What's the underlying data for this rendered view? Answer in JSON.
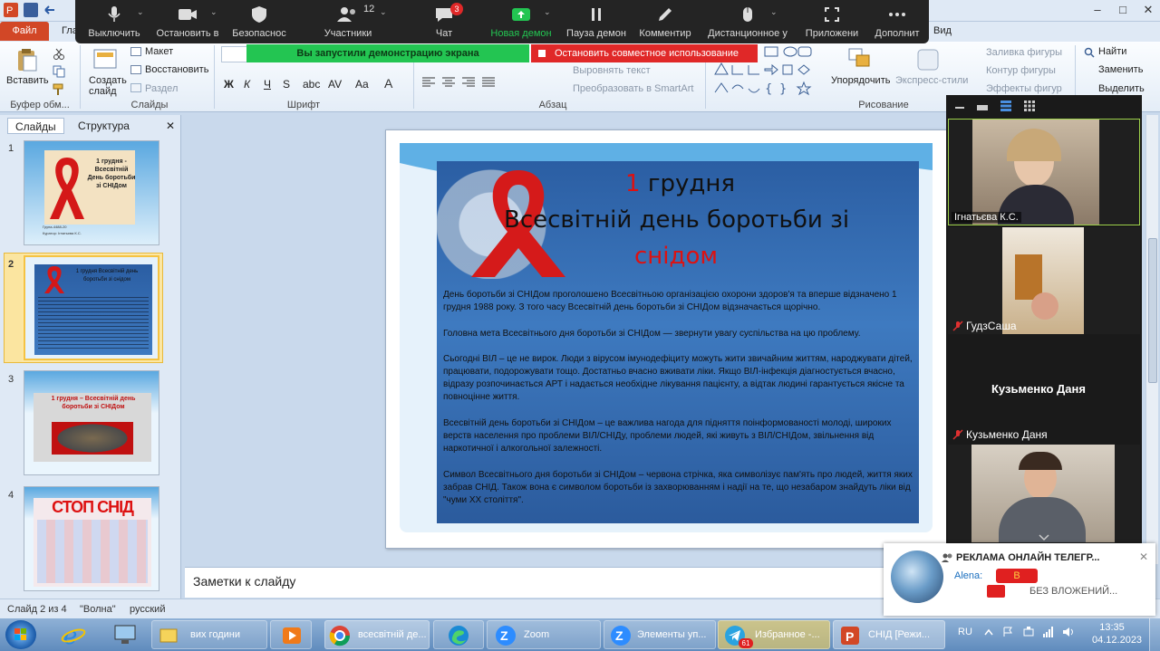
{
  "window": {
    "title": "",
    "title_right": "",
    "minimize": "–",
    "maximize": "□",
    "close": "✕"
  },
  "ribbon": {
    "file_tab": "Файл",
    "tab_main": "Гла",
    "tab_view": "Вид",
    "groups": {
      "clipboard": "Буфер обм...",
      "slides": "Слайды",
      "font": "Шрифт",
      "paragraph": "Абзац",
      "drawing": "Рисование"
    },
    "paste": "Вставить",
    "create_slide": "Создать слайд",
    "layout": "Макет",
    "restore": "Восстановить",
    "section": "Раздел",
    "align_text": "Выровнять текст",
    "smartart": "Преобразовать в SmartArt",
    "arrange": "Упорядочить",
    "express_styles": "Экспресс-стили",
    "shape_fill": "Заливка фигуры",
    "shape_outline": "Контур фигуры",
    "shape_effects": "Эффекты фигур",
    "find": "Найти",
    "replace": "Заменить",
    "select": "Выделить"
  },
  "zoom_toolbar": {
    "items": [
      {
        "label": "Выключить"
      },
      {
        "label": "Остановить в"
      },
      {
        "label": "Безопаснос"
      },
      {
        "label": "Участники",
        "count": "12"
      },
      {
        "label": "Чат",
        "badge": "3"
      },
      {
        "label": "Новая демон"
      },
      {
        "label": "Пауза демон"
      },
      {
        "label": "Комментир"
      },
      {
        "label": "Дистанционное у"
      },
      {
        "label": "Приложени"
      },
      {
        "label": "Дополнит"
      }
    ],
    "share_banner": "Вы запустили демонстрацию экрана",
    "stop_share": "Остановить совместное использование"
  },
  "left_panel": {
    "tab_slides": "Слайды",
    "tab_structure": "Структура",
    "close": "✕",
    "slides": [
      {
        "num": "1",
        "title": "1 грудня - Всесвітній День боротьби зі СНІДом",
        "caption1": "Група-4488-20",
        "caption2": "Куратор: Ігнатьєва К.С."
      },
      {
        "num": "2",
        "title": "1 грудня Всесвітній день боротьби зі снідом"
      },
      {
        "num": "3",
        "title": "1 грудня – Всесвітній день боротьби зі СНІДом"
      },
      {
        "num": "4",
        "title": "СТОП СНІД"
      }
    ]
  },
  "slide": {
    "title_num": "1",
    "title_word": "грудня",
    "title_line2": "Всесвітній день боротьби зі",
    "title_line3": "снідом",
    "paragraphs": [
      "День боротьби зі СНІДом проголошено Всесвітньою організацією охорони здоров'я та вперше відзначено 1 грудня 1988 року. З того часу Всесвітній день боротьби зі СНІДом відзначається щорічно.",
      "Головна мета Всесвітнього дня боротьби зі СНІДом — звернути увагу суспільства на цю проблему.",
      "Сьогодні ВІЛ – це не вирок. Люди  з вірусом імунодефіциту можуть жити звичайним життям, народжувати дітей, працювати, подорожувати тощо. Достатньо вчасно вживати ліки. Якщо ВІЛ-інфекція діагностується вчасно, відразу розпочинається АРТ і надається необхідне лікування пацієнту, а відтак людині гарантується якісне та повноцінне життя.",
      "Всесвітній день боротьби зі СНІДом – це важлива нагода для підняття поінформованості молоді, широких верств населення про проблеми ВІЛ/СНІДу, проблеми людей, які живуть з ВІЛ/СНІДом, звільнення від наркотичної і алкогольної залежності.",
      "Символ  Всесвітнього дня боротьби зі СНІДом – червона стрічка, яка символізує пам'ять про людей, життя яких забрав СНІД. Також вона є символом боротьби із захворюванням і надії на те, що незабаром знайдуть ліки від \"чуми XX століття\"."
    ]
  },
  "notes_placeholder": "Заметки к слайду",
  "status": {
    "slide_of": "Слайд 2 из 4",
    "theme": "\"Волна\"",
    "language": "русский"
  },
  "video_panel": {
    "participants": [
      {
        "name": "Ігнатьєва К.С."
      },
      {
        "name": "ГудзСаша"
      },
      {
        "name": "Кузьменко Даня"
      },
      {
        "name": "Кузьменко Даня"
      }
    ]
  },
  "notification": {
    "title": "РЕКЛАМА ОНЛАЙН ТЕЛЕГР...",
    "author": "Alena:",
    "author_tag": "В",
    "message": "БЕЗ ВЛОЖЕНИЙ..."
  },
  "taskbar": {
    "items": [
      {
        "label": "вих години"
      },
      {
        "label": "всесвітній де..."
      },
      {
        "label": "Zoom"
      },
      {
        "label": "Элементы уп..."
      },
      {
        "label": "Избранное -..."
      },
      {
        "label": "СНІД [Режи..."
      }
    ],
    "telegram_badge": "61",
    "lang": "RU",
    "time": "13:35",
    "date": "04.12.2023"
  },
  "colors": {
    "file_tab": "#d24726",
    "share_green": "#23c552",
    "stop_red": "#e02828",
    "slide_blue": "#2b5ea3",
    "ribbon_red": "#d11111"
  }
}
